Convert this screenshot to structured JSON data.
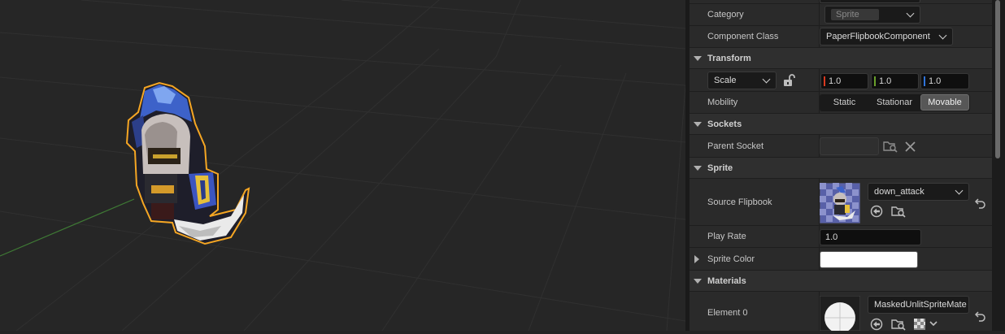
{
  "colors": {
    "selection_outline": "#f5a623",
    "axis_x": "#d9391f",
    "axis_y": "#6aa02b",
    "axis_z": "#2f73d9",
    "grid_green": "#3f7a35"
  },
  "details": {
    "category": {
      "label": "Category",
      "value": "Sprite"
    },
    "component_class": {
      "label": "Component Class",
      "value": "PaperFlipbookComponent"
    },
    "transform": {
      "title": "Transform",
      "scale_mode": "Scale",
      "scale": {
        "x": "1.0",
        "y": "1.0",
        "z": "1.0"
      },
      "mobility_label": "Mobility",
      "mobility_options": [
        "Static",
        "Stationar",
        "Movable"
      ],
      "mobility_selected": "Movable"
    },
    "sockets": {
      "title": "Sockets",
      "parent_socket_label": "Parent Socket",
      "parent_socket_value": ""
    },
    "sprite": {
      "title": "Sprite",
      "source_flipbook_label": "Source Flipbook",
      "source_flipbook_value": "down_attack",
      "play_rate_label": "Play Rate",
      "play_rate_value": "1.0",
      "sprite_color_label": "Sprite Color",
      "sprite_color_value": "#ffffff"
    },
    "materials": {
      "title": "Materials",
      "element0_label": "Element 0",
      "element0_value": "MaskedUnlitSpriteMate"
    }
  }
}
